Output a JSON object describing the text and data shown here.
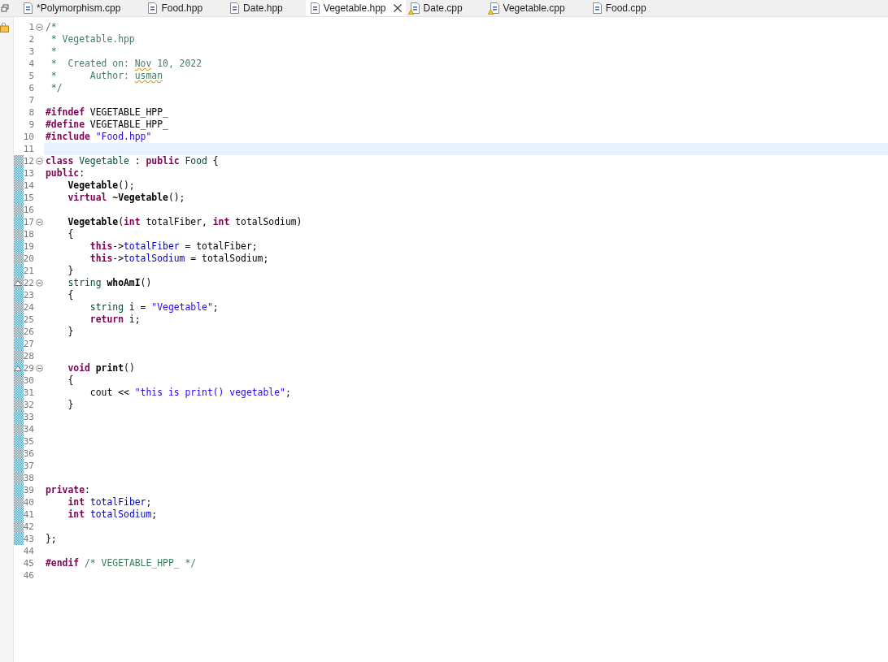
{
  "tabs": [
    {
      "label": "*Polymorphism.cpp",
      "kind": "source",
      "warning": false,
      "selected": false
    },
    {
      "label": "Food.hpp",
      "kind": "header",
      "warning": false,
      "selected": false
    },
    {
      "label": "Date.hpp",
      "kind": "header",
      "warning": false,
      "selected": false
    },
    {
      "label": "Vegetable.hpp",
      "kind": "header",
      "warning": false,
      "selected": true
    },
    {
      "label": "Date.cpp",
      "kind": "source",
      "warning": true,
      "selected": false
    },
    {
      "label": "Vegetable.cpp",
      "kind": "source",
      "warning": true,
      "selected": false
    },
    {
      "label": "Food.cpp",
      "kind": "source",
      "warning": false,
      "selected": false
    }
  ],
  "editor": {
    "lines": [
      {
        "n": "1",
        "fold": true,
        "changed": false,
        "override": false,
        "current": false,
        "tokens": [
          {
            "kind": "comment",
            "text": "/*"
          }
        ]
      },
      {
        "n": "2",
        "fold": false,
        "changed": false,
        "override": false,
        "current": false,
        "tokens": [
          {
            "kind": "comment",
            "text": " * Vegetable.hpp"
          }
        ]
      },
      {
        "n": "3",
        "fold": false,
        "changed": false,
        "override": false,
        "current": false,
        "tokens": [
          {
            "kind": "comment",
            "text": " *"
          }
        ]
      },
      {
        "n": "4",
        "fold": false,
        "changed": false,
        "override": false,
        "current": false,
        "tokens": [
          {
            "kind": "comment",
            "text": " *  Created on: "
          },
          {
            "kind": "misspelled",
            "text": "Nov"
          },
          {
            "kind": "comment",
            "text": " 10, 2022"
          }
        ]
      },
      {
        "n": "5",
        "fold": false,
        "changed": false,
        "override": false,
        "current": false,
        "tokens": [
          {
            "kind": "comment",
            "text": " *      Author: "
          },
          {
            "kind": "misspelled",
            "text": "usman"
          }
        ]
      },
      {
        "n": "6",
        "fold": false,
        "changed": false,
        "override": false,
        "current": false,
        "tokens": [
          {
            "kind": "comment",
            "text": " */"
          }
        ]
      },
      {
        "n": "7",
        "fold": false,
        "changed": false,
        "override": false,
        "current": false
      },
      {
        "n": "8",
        "fold": false,
        "changed": false,
        "override": false,
        "current": false,
        "tokens": [
          {
            "kind": "keyword",
            "text": "#ifndef"
          },
          {
            "kind": "plain",
            "text": " VEGETABLE_HPP_"
          }
        ]
      },
      {
        "n": "9",
        "fold": false,
        "changed": false,
        "override": false,
        "current": false,
        "tokens": [
          {
            "kind": "keyword",
            "text": "#define"
          },
          {
            "kind": "plain",
            "text": " VEGETABLE_HPP_"
          }
        ]
      },
      {
        "n": "10",
        "fold": false,
        "changed": false,
        "override": false,
        "current": false,
        "tokens": [
          {
            "kind": "keyword",
            "text": "#include "
          },
          {
            "kind": "string",
            "text": "\"Food.hpp\""
          }
        ]
      },
      {
        "n": "11",
        "fold": false,
        "changed": false,
        "override": false,
        "current": true
      },
      {
        "n": "12",
        "fold": true,
        "changed": true,
        "override": false,
        "current": false,
        "tokens": [
          {
            "kind": "keyword",
            "text": "class "
          },
          {
            "kind": "type",
            "text": "Vegetable"
          },
          {
            "kind": "plain",
            "text": " : "
          },
          {
            "kind": "keyword",
            "text": "public "
          },
          {
            "kind": "type",
            "text": "Food"
          },
          {
            "kind": "plain",
            "text": " {"
          }
        ]
      },
      {
        "n": "13",
        "fold": false,
        "changed": true,
        "override": false,
        "current": false,
        "tokens": [
          {
            "kind": "keyword",
            "text": "public"
          },
          {
            "kind": "plain",
            "text": ":"
          }
        ]
      },
      {
        "n": "14",
        "fold": false,
        "changed": true,
        "override": false,
        "current": false,
        "tokens": [
          {
            "kind": "func",
            "text": "    Vegetable"
          },
          {
            "kind": "plain",
            "text": "();"
          }
        ]
      },
      {
        "n": "15",
        "fold": false,
        "changed": true,
        "override": false,
        "current": false,
        "tokens": [
          {
            "kind": "keyword",
            "text": "    virtual "
          },
          {
            "kind": "func",
            "text": "~Vegetable"
          },
          {
            "kind": "plain",
            "text": "();"
          }
        ]
      },
      {
        "n": "16",
        "fold": false,
        "changed": true,
        "override": false,
        "current": false
      },
      {
        "n": "17",
        "fold": true,
        "changed": true,
        "override": false,
        "current": false,
        "tokens": [
          {
            "kind": "func",
            "text": "    Vegetable"
          },
          {
            "kind": "plain",
            "text": "("
          },
          {
            "kind": "keyword",
            "text": "int"
          },
          {
            "kind": "plain",
            "text": " totalFiber, "
          },
          {
            "kind": "keyword",
            "text": "int"
          },
          {
            "kind": "plain",
            "text": " totalSodium)"
          }
        ]
      },
      {
        "n": "18",
        "fold": false,
        "changed": true,
        "override": false,
        "current": false,
        "tokens": [
          {
            "kind": "plain",
            "text": "    {"
          }
        ]
      },
      {
        "n": "19",
        "fold": false,
        "changed": true,
        "override": false,
        "current": false,
        "tokens": [
          {
            "kind": "keyword",
            "text": "        this"
          },
          {
            "kind": "plain",
            "text": "->"
          },
          {
            "kind": "field",
            "text": "totalFiber"
          },
          {
            "kind": "plain",
            "text": " = totalFiber;"
          }
        ]
      },
      {
        "n": "20",
        "fold": false,
        "changed": true,
        "override": false,
        "current": false,
        "tokens": [
          {
            "kind": "keyword",
            "text": "        this"
          },
          {
            "kind": "plain",
            "text": "->"
          },
          {
            "kind": "field",
            "text": "totalSodium"
          },
          {
            "kind": "plain",
            "text": " = totalSodium;"
          }
        ]
      },
      {
        "n": "21",
        "fold": false,
        "changed": true,
        "override": false,
        "current": false,
        "tokens": [
          {
            "kind": "plain",
            "text": "    }"
          }
        ]
      },
      {
        "n": "22",
        "fold": true,
        "changed": true,
        "override": true,
        "current": false,
        "tokens": [
          {
            "kind": "type",
            "text": "    string "
          },
          {
            "kind": "func",
            "text": "whoAmI"
          },
          {
            "kind": "plain",
            "text": "()"
          }
        ]
      },
      {
        "n": "23",
        "fold": false,
        "changed": true,
        "override": false,
        "current": false,
        "tokens": [
          {
            "kind": "plain",
            "text": "    {"
          }
        ]
      },
      {
        "n": "24",
        "fold": false,
        "changed": true,
        "override": false,
        "current": false,
        "tokens": [
          {
            "kind": "type",
            "text": "        string"
          },
          {
            "kind": "plain",
            "text": " i = "
          },
          {
            "kind": "string",
            "text": "\"Vegetable\""
          },
          {
            "kind": "plain",
            "text": ";"
          }
        ]
      },
      {
        "n": "25",
        "fold": false,
        "changed": true,
        "override": false,
        "current": false,
        "tokens": [
          {
            "kind": "keyword",
            "text": "        return"
          },
          {
            "kind": "plain",
            "text": " i;"
          }
        ]
      },
      {
        "n": "26",
        "fold": false,
        "changed": true,
        "override": false,
        "current": false,
        "tokens": [
          {
            "kind": "plain",
            "text": "    }"
          }
        ]
      },
      {
        "n": "27",
        "fold": false,
        "changed": true,
        "override": false,
        "current": false
      },
      {
        "n": "28",
        "fold": false,
        "changed": true,
        "override": false,
        "current": false
      },
      {
        "n": "29",
        "fold": true,
        "changed": true,
        "override": true,
        "current": false,
        "tokens": [
          {
            "kind": "keyword",
            "text": "    void "
          },
          {
            "kind": "func",
            "text": "print"
          },
          {
            "kind": "plain",
            "text": "()"
          }
        ]
      },
      {
        "n": "30",
        "fold": false,
        "changed": true,
        "override": false,
        "current": false,
        "tokens": [
          {
            "kind": "plain",
            "text": "    {"
          }
        ]
      },
      {
        "n": "31",
        "fold": false,
        "changed": true,
        "override": false,
        "current": false,
        "tokens": [
          {
            "kind": "plain",
            "text": "        cout << "
          },
          {
            "kind": "string",
            "text": "\"this is print() vegetable\""
          },
          {
            "kind": "plain",
            "text": ";"
          }
        ]
      },
      {
        "n": "32",
        "fold": false,
        "changed": true,
        "override": false,
        "current": false,
        "tokens": [
          {
            "kind": "plain",
            "text": "    }"
          }
        ]
      },
      {
        "n": "33",
        "fold": false,
        "changed": true,
        "override": false,
        "current": false
      },
      {
        "n": "34",
        "fold": false,
        "changed": true,
        "override": false,
        "current": false
      },
      {
        "n": "35",
        "fold": false,
        "changed": true,
        "override": false,
        "current": false
      },
      {
        "n": "36",
        "fold": false,
        "changed": true,
        "override": false,
        "current": false
      },
      {
        "n": "37",
        "fold": false,
        "changed": true,
        "override": false,
        "current": false
      },
      {
        "n": "38",
        "fold": false,
        "changed": true,
        "override": false,
        "current": false
      },
      {
        "n": "39",
        "fold": false,
        "changed": true,
        "override": false,
        "current": false,
        "tokens": [
          {
            "kind": "keyword",
            "text": "private"
          },
          {
            "kind": "plain",
            "text": ":"
          }
        ]
      },
      {
        "n": "40",
        "fold": false,
        "changed": true,
        "override": false,
        "current": false,
        "tokens": [
          {
            "kind": "keyword",
            "text": "    int "
          },
          {
            "kind": "field",
            "text": "totalFiber"
          },
          {
            "kind": "plain",
            "text": ";"
          }
        ]
      },
      {
        "n": "41",
        "fold": false,
        "changed": true,
        "override": false,
        "current": false,
        "tokens": [
          {
            "kind": "keyword",
            "text": "    int "
          },
          {
            "kind": "field",
            "text": "totalSodium"
          },
          {
            "kind": "plain",
            "text": ";"
          }
        ]
      },
      {
        "n": "42",
        "fold": false,
        "changed": true,
        "override": false,
        "current": false
      },
      {
        "n": "43",
        "fold": false,
        "changed": true,
        "override": false,
        "current": false,
        "tokens": [
          {
            "kind": "plain",
            "text": "};"
          }
        ]
      },
      {
        "n": "44",
        "fold": false,
        "changed": false,
        "override": false,
        "current": false
      },
      {
        "n": "45",
        "fold": false,
        "changed": false,
        "override": false,
        "current": false,
        "tokens": [
          {
            "kind": "keyword",
            "text": "#endif "
          },
          {
            "kind": "comment",
            "text": "/* VEGETABLE_HPP_ */"
          }
        ]
      },
      {
        "n": "46",
        "fold": false,
        "changed": false,
        "override": false,
        "current": false
      }
    ]
  }
}
